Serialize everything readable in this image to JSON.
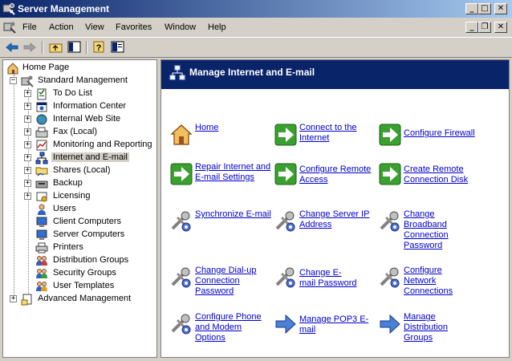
{
  "window": {
    "title": "Server Management",
    "min_label": "_",
    "max_label": "□",
    "close_label": "✕"
  },
  "menubar": {
    "items": [
      "File",
      "Action",
      "View",
      "Favorites",
      "Window",
      "Help"
    ],
    "child_controls": {
      "min_label": "_",
      "restore_label": "❐",
      "close_label": "✕"
    }
  },
  "toolbar": {
    "buttons": [
      "back-arrow-icon",
      "forward-arrow-icon",
      "up-folder-icon",
      "show-hide-tree-icon",
      "help-icon",
      "properties-icon"
    ]
  },
  "tree": {
    "home": "Home Page",
    "standard": "Standard Management",
    "items": [
      {
        "label": "To Do List",
        "icon": "todo-icon",
        "expandable": true
      },
      {
        "label": "Information Center",
        "icon": "info-icon",
        "expandable": true
      },
      {
        "label": "Internal Web Site",
        "icon": "web-icon",
        "expandable": true
      },
      {
        "label": "Fax (Local)",
        "icon": "fax-icon",
        "expandable": true
      },
      {
        "label": "Monitoring and Reporting",
        "icon": "monitor-icon",
        "expandable": true
      },
      {
        "label": "Internet and E-mail",
        "icon": "network-icon",
        "expandable": true,
        "selected": true
      },
      {
        "label": "Shares (Local)",
        "icon": "shares-icon",
        "expandable": true
      },
      {
        "label": "Backup",
        "icon": "backup-icon",
        "expandable": true
      },
      {
        "label": "Licensing",
        "icon": "licensing-icon",
        "expandable": true
      },
      {
        "label": "Users",
        "icon": "users-icon",
        "expandable": false
      },
      {
        "label": "Client Computers",
        "icon": "computer-icon",
        "expandable": false
      },
      {
        "label": "Server Computers",
        "icon": "computer-icon",
        "expandable": false
      },
      {
        "label": "Printers",
        "icon": "printer-icon",
        "expandable": false
      },
      {
        "label": "Distribution Groups",
        "icon": "group-icon",
        "expandable": false
      },
      {
        "label": "Security Groups",
        "icon": "group-icon",
        "expandable": false
      },
      {
        "label": "User Templates",
        "icon": "group-icon",
        "expandable": false
      }
    ],
    "advanced": "Advanced Management"
  },
  "content": {
    "header": "Manage Internet and E-mail",
    "tasks": [
      {
        "label": "Home",
        "icon": "home-icon"
      },
      {
        "label": "Connect to the Internet",
        "icon": "green-arrow-icon"
      },
      {
        "label": "Configure Firewall",
        "icon": "green-arrow-icon"
      },
      {
        "label": "Repair Internet and E-mail Settings",
        "icon": "green-arrow-icon"
      },
      {
        "label": "Configure Remote Access",
        "icon": "green-arrow-icon"
      },
      {
        "label": "Create Remote Connection Disk",
        "icon": "green-arrow-icon"
      },
      {
        "label": "Synchronize E-mail",
        "icon": "tools-icon"
      },
      {
        "label": "Change Server IP Address",
        "icon": "tools-icon"
      },
      {
        "label": "Change Broadband Connection Password",
        "icon": "tools-icon"
      },
      {
        "label": "Change Dial-up Connection Password",
        "icon": "tools-icon"
      },
      {
        "label": "Change E-mail Password",
        "icon": "tools-icon"
      },
      {
        "label": "Configure Network Connections",
        "icon": "tools-icon"
      },
      {
        "label": "Configure Phone and Modem Options",
        "icon": "tools-icon"
      },
      {
        "label": "Manage POP3 E-mail",
        "icon": "blue-arrow-icon"
      },
      {
        "label": "Manage Distribution Groups",
        "icon": "blue-arrow-icon"
      }
    ]
  },
  "colors": {
    "title_bar": "#0a246a",
    "link": "#0000cc",
    "face": "#d4d0c8"
  }
}
